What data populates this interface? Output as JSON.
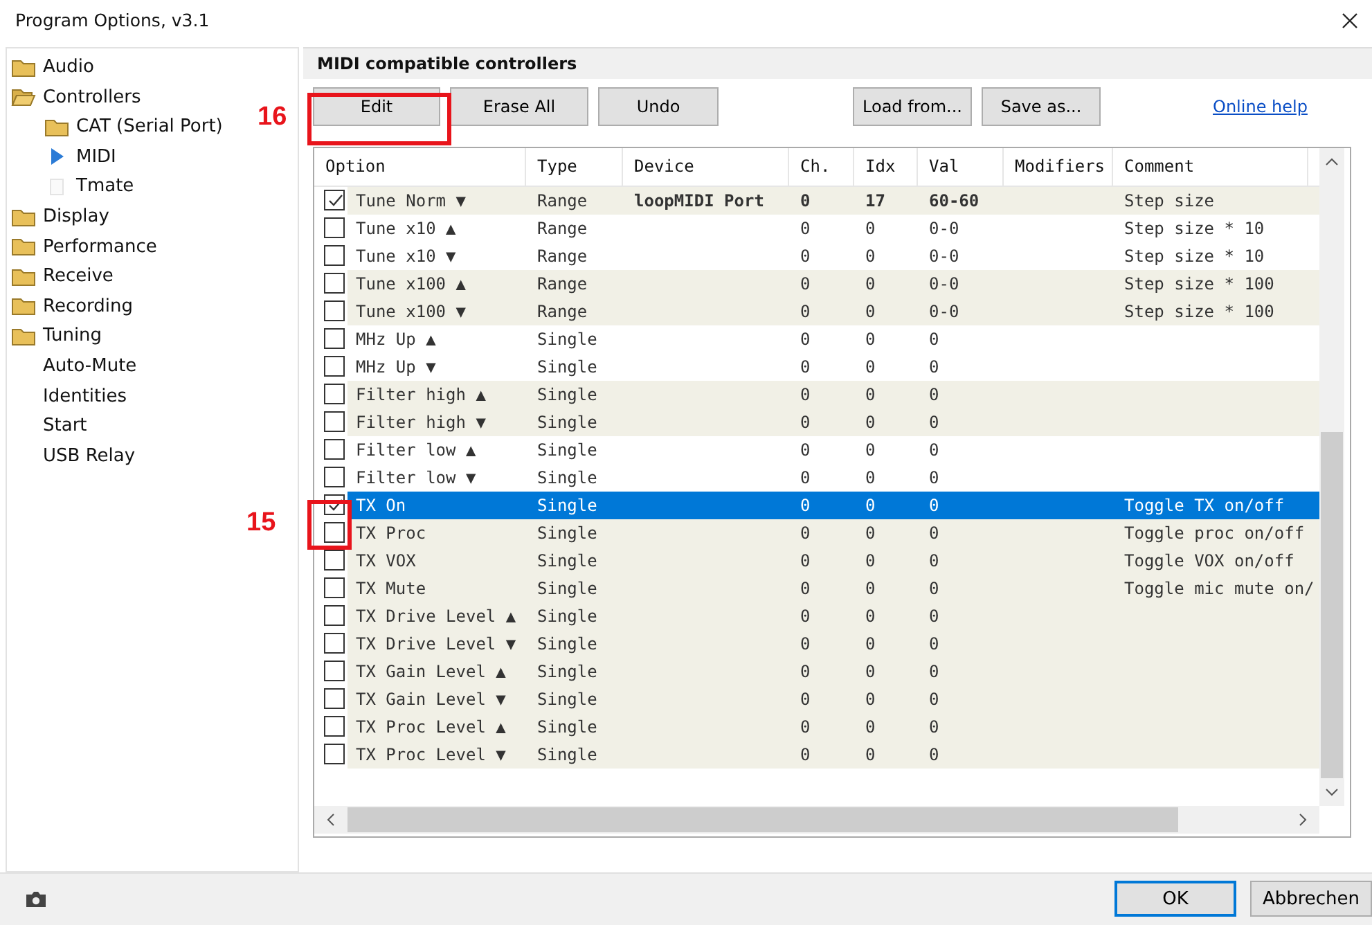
{
  "window": {
    "title": "Program Options, v3.1"
  },
  "sidebar": {
    "items": [
      {
        "label": "Audio",
        "kind": "folder"
      },
      {
        "label": "Controllers",
        "kind": "folder",
        "expanded": true,
        "children": [
          {
            "label": "CAT (Serial Port)",
            "kind": "folder",
            "selected": false
          },
          {
            "label": "MIDI",
            "selected": true
          },
          {
            "label": "Tmate",
            "kind": "blank",
            "selected": false
          }
        ]
      },
      {
        "label": "Display",
        "kind": "folder"
      },
      {
        "label": "Performance",
        "kind": "folder"
      },
      {
        "label": "Receive",
        "kind": "folder"
      },
      {
        "label": "Recording",
        "kind": "folder"
      },
      {
        "label": "Tuning",
        "kind": "folder"
      },
      {
        "label": "Auto-Mute",
        "kind": "plain"
      },
      {
        "label": "Identities",
        "kind": "plain"
      },
      {
        "label": "Start",
        "kind": "plain"
      },
      {
        "label": "USB Relay",
        "kind": "plain"
      }
    ]
  },
  "panel": {
    "title": "MIDI compatible controllers",
    "buttons": [
      "Edit",
      "Erase All",
      "Undo"
    ],
    "file_buttons": [
      "Load from...",
      "Save as..."
    ],
    "help_link": "Online help"
  },
  "table": {
    "columns": [
      "Option",
      "Type",
      "Device",
      "Ch.",
      "Idx",
      "Val",
      "Modifiers",
      "Comment"
    ],
    "rows": [
      {
        "checked": true,
        "shaded": true,
        "selected": false,
        "cells": [
          "Tune Norm ▼",
          "Range",
          "loopMIDI Port",
          "0",
          "17",
          "60-60",
          "",
          "Step size"
        ]
      },
      {
        "checked": false,
        "shaded": false,
        "selected": false,
        "cells": [
          "Tune x10 ▲",
          "Range",
          "",
          "0",
          "0",
          "0-0",
          "",
          "Step size * 10"
        ]
      },
      {
        "checked": false,
        "shaded": false,
        "selected": false,
        "cells": [
          "Tune x10 ▼",
          "Range",
          "",
          "0",
          "0",
          "0-0",
          "",
          "Step size * 10"
        ]
      },
      {
        "checked": false,
        "shaded": true,
        "selected": false,
        "cells": [
          "Tune x100 ▲",
          "Range",
          "",
          "0",
          "0",
          "0-0",
          "",
          "Step size * 100"
        ]
      },
      {
        "checked": false,
        "shaded": true,
        "selected": false,
        "cells": [
          "Tune x100 ▼",
          "Range",
          "",
          "0",
          "0",
          "0-0",
          "",
          "Step size * 100"
        ]
      },
      {
        "checked": false,
        "shaded": false,
        "selected": false,
        "cells": [
          "MHz Up ▲",
          "Single",
          "",
          "0",
          "0",
          "0",
          "",
          ""
        ]
      },
      {
        "checked": false,
        "shaded": false,
        "selected": false,
        "cells": [
          "MHz Up ▼",
          "Single",
          "",
          "0",
          "0",
          "0",
          "",
          ""
        ]
      },
      {
        "checked": false,
        "shaded": true,
        "selected": false,
        "cells": [
          "Filter high ▲",
          "Single",
          "",
          "0",
          "0",
          "0",
          "",
          ""
        ]
      },
      {
        "checked": false,
        "shaded": true,
        "selected": false,
        "cells": [
          "Filter high ▼",
          "Single",
          "",
          "0",
          "0",
          "0",
          "",
          ""
        ]
      },
      {
        "checked": false,
        "shaded": false,
        "selected": false,
        "cells": [
          "Filter low ▲",
          "Single",
          "",
          "0",
          "0",
          "0",
          "",
          ""
        ]
      },
      {
        "checked": false,
        "shaded": false,
        "selected": false,
        "cells": [
          "Filter low ▼",
          "Single",
          "",
          "0",
          "0",
          "0",
          "",
          ""
        ]
      },
      {
        "checked": true,
        "shaded": true,
        "selected": true,
        "cells": [
          "TX On",
          "Single",
          "",
          "0",
          "0",
          "0",
          "",
          "Toggle TX on/off"
        ]
      },
      {
        "checked": false,
        "shaded": true,
        "selected": false,
        "cells": [
          "TX Proc",
          "Single",
          "",
          "0",
          "0",
          "0",
          "",
          "Toggle proc on/off"
        ]
      },
      {
        "checked": false,
        "shaded": true,
        "selected": false,
        "cells": [
          "TX VOX",
          "Single",
          "",
          "0",
          "0",
          "0",
          "",
          "Toggle VOX on/off"
        ]
      },
      {
        "checked": false,
        "shaded": true,
        "selected": false,
        "cells": [
          "TX Mute",
          "Single",
          "",
          "0",
          "0",
          "0",
          "",
          "Toggle mic mute on/"
        ]
      },
      {
        "checked": false,
        "shaded": true,
        "selected": false,
        "cells": [
          "TX Drive Level ▲",
          "Single",
          "",
          "0",
          "0",
          "0",
          "",
          ""
        ]
      },
      {
        "checked": false,
        "shaded": true,
        "selected": false,
        "cells": [
          "TX Drive Level ▼",
          "Single",
          "",
          "0",
          "0",
          "0",
          "",
          ""
        ]
      },
      {
        "checked": false,
        "shaded": true,
        "selected": false,
        "cells": [
          "TX Gain Level ▲",
          "Single",
          "",
          "0",
          "0",
          "0",
          "",
          ""
        ]
      },
      {
        "checked": false,
        "shaded": true,
        "selected": false,
        "cells": [
          "TX Gain Level ▼",
          "Single",
          "",
          "0",
          "0",
          "0",
          "",
          ""
        ]
      },
      {
        "checked": false,
        "shaded": true,
        "selected": false,
        "cells": [
          "TX Proc Level ▲",
          "Single",
          "",
          "0",
          "0",
          "0",
          "",
          ""
        ]
      },
      {
        "checked": false,
        "shaded": true,
        "selected": false,
        "cells": [
          "TX Proc Level ▼",
          "Single",
          "",
          "0",
          "0",
          "0",
          "",
          ""
        ]
      }
    ]
  },
  "footer": {
    "buttons": [
      "OK",
      "Abbrechen"
    ]
  },
  "annotations": [
    {
      "label": "16"
    },
    {
      "label": "15"
    }
  ]
}
